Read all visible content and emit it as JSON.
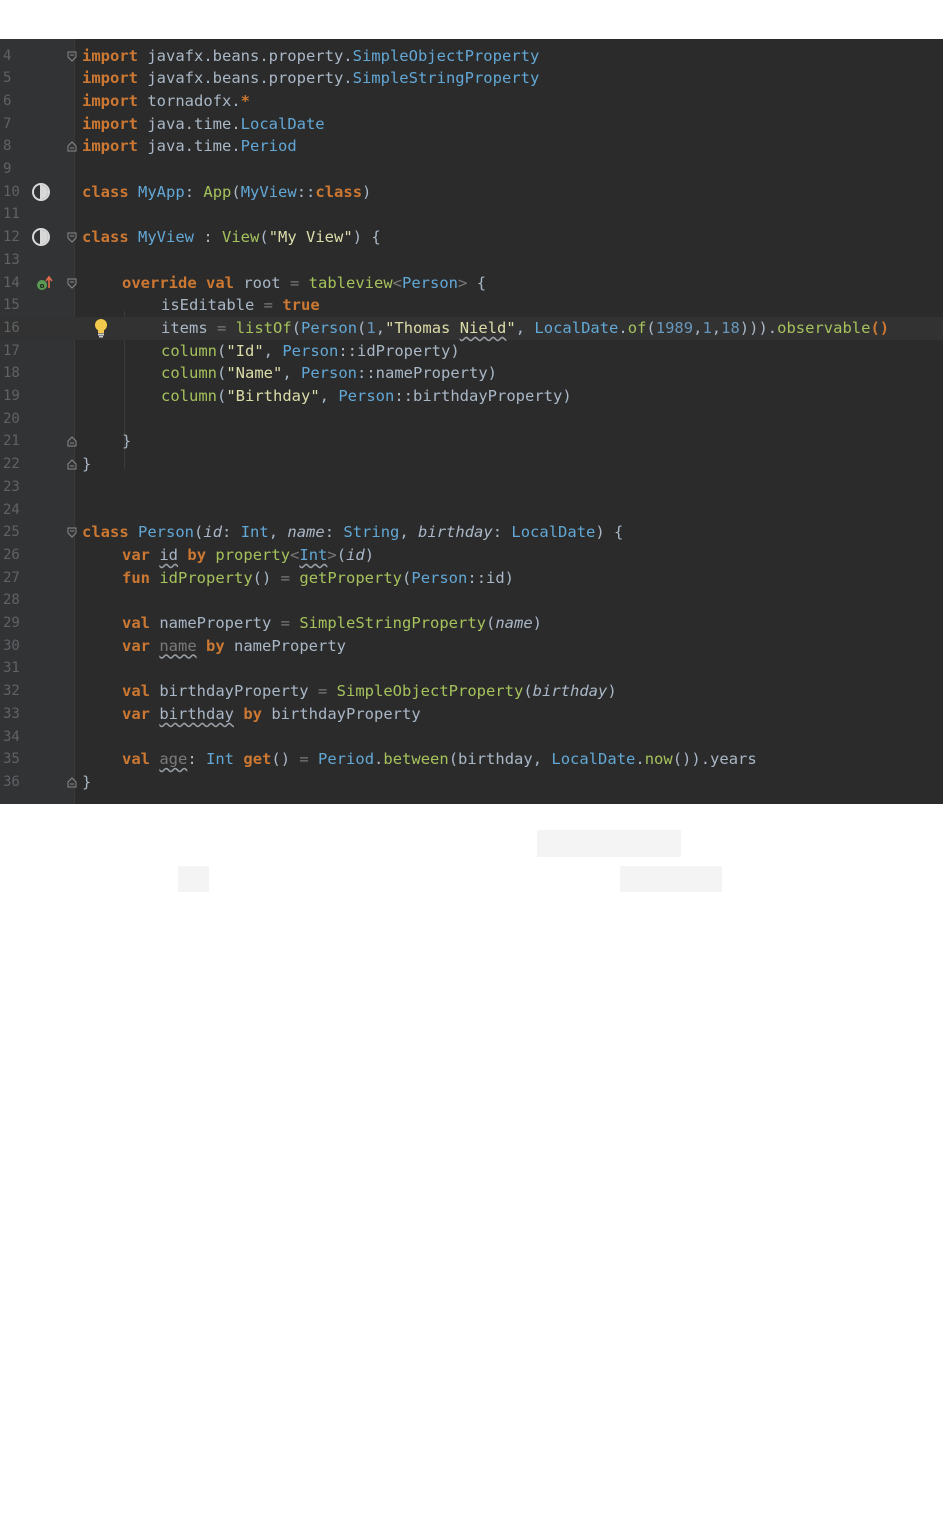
{
  "editor": {
    "lines": [
      {
        "n": "4",
        "parts": [
          {
            "c": "kw",
            "t": "import"
          },
          {
            "c": "",
            "t": " javafx.beans.property."
          },
          {
            "c": "cls",
            "t": "SimpleObjectProperty"
          }
        ]
      },
      {
        "n": "5",
        "parts": [
          {
            "c": "kw",
            "t": "import"
          },
          {
            "c": "",
            "t": " javafx.beans.property."
          },
          {
            "c": "cls",
            "t": "SimpleStringProperty"
          }
        ]
      },
      {
        "n": "6",
        "parts": [
          {
            "c": "kw",
            "t": "import"
          },
          {
            "c": "",
            "t": " tornadofx."
          },
          {
            "c": "kw",
            "t": "*"
          }
        ]
      },
      {
        "n": "7",
        "parts": [
          {
            "c": "kw",
            "t": "import"
          },
          {
            "c": "",
            "t": " java.time."
          },
          {
            "c": "cls",
            "t": "LocalDate"
          }
        ]
      },
      {
        "n": "8",
        "parts": [
          {
            "c": "kw",
            "t": "import"
          },
          {
            "c": "",
            "t": " java.time."
          },
          {
            "c": "cls",
            "t": "Period"
          }
        ]
      },
      {
        "n": "9",
        "parts": []
      },
      {
        "n": "10",
        "parts": [
          {
            "c": "kw",
            "t": "class"
          },
          {
            "c": "",
            "t": " "
          },
          {
            "c": "cls",
            "t": "MyApp"
          },
          {
            "c": "",
            "t": ": "
          },
          {
            "c": "grn",
            "t": "App"
          },
          {
            "c": "",
            "t": "("
          },
          {
            "c": "cls",
            "t": "MyView"
          },
          {
            "c": "",
            "t": "::"
          },
          {
            "c": "kw",
            "t": "class"
          },
          {
            "c": "",
            "t": ")"
          }
        ]
      },
      {
        "n": "11",
        "parts": []
      },
      {
        "n": "12",
        "parts": [
          {
            "c": "kw",
            "t": "class"
          },
          {
            "c": "",
            "t": " "
          },
          {
            "c": "cls",
            "t": "MyView"
          },
          {
            "c": "",
            "t": " : "
          },
          {
            "c": "grn",
            "t": "View"
          },
          {
            "c": "",
            "t": "("
          },
          {
            "c": "str",
            "t": "\"My View\""
          },
          {
            "c": "",
            "t": ") {"
          }
        ]
      },
      {
        "n": "13",
        "parts": []
      },
      {
        "n": "14",
        "parts": [
          {
            "c": "kw",
            "t": "override val"
          },
          {
            "c": "",
            "t": " root "
          },
          {
            "c": "grey",
            "t": "="
          },
          {
            "c": "",
            "t": " "
          },
          {
            "c": "grn",
            "t": "tableview"
          },
          {
            "c": "grey",
            "t": "<"
          },
          {
            "c": "cls",
            "t": "Person"
          },
          {
            "c": "grey",
            "t": ">"
          },
          {
            "c": "",
            "t": " {"
          }
        ]
      },
      {
        "n": "15",
        "parts": [
          {
            "c": "",
            "t": "isEditable "
          },
          {
            "c": "grey",
            "t": "="
          },
          {
            "c": "",
            "t": " "
          },
          {
            "c": "kw",
            "t": "true"
          }
        ]
      },
      {
        "n": "16",
        "parts": [
          {
            "c": "",
            "t": "items "
          },
          {
            "c": "grey",
            "t": "="
          },
          {
            "c": "",
            "t": " "
          },
          {
            "c": "grn",
            "t": "listOf"
          },
          {
            "c": "",
            "t": "("
          },
          {
            "c": "cls",
            "t": "Person"
          },
          {
            "c": "",
            "t": "("
          },
          {
            "c": "num",
            "t": "1"
          },
          {
            "c": "",
            "t": ","
          },
          {
            "c": "str",
            "t": "\"Thomas "
          },
          {
            "c": "str wavy",
            "t": "Nield"
          },
          {
            "c": "str",
            "t": "\""
          },
          {
            "c": "",
            "t": ", "
          },
          {
            "c": "cls",
            "t": "LocalDate"
          },
          {
            "c": "",
            "t": "."
          },
          {
            "c": "grn",
            "t": "of"
          },
          {
            "c": "",
            "t": "("
          },
          {
            "c": "num",
            "t": "1989"
          },
          {
            "c": "",
            "t": ","
          },
          {
            "c": "num",
            "t": "1"
          },
          {
            "c": "",
            "t": ","
          },
          {
            "c": "num",
            "t": "18"
          },
          {
            "c": "",
            "t": ")))."
          },
          {
            "c": "grn",
            "t": "observable"
          },
          {
            "c": "kw",
            "t": "()"
          }
        ]
      },
      {
        "n": "17",
        "parts": [
          {
            "c": "grn",
            "t": "column"
          },
          {
            "c": "",
            "t": "("
          },
          {
            "c": "str",
            "t": "\"Id\""
          },
          {
            "c": "",
            "t": ", "
          },
          {
            "c": "cls",
            "t": "Person"
          },
          {
            "c": "",
            "t": "::idProperty)"
          }
        ]
      },
      {
        "n": "18",
        "parts": [
          {
            "c": "grn",
            "t": "column"
          },
          {
            "c": "",
            "t": "("
          },
          {
            "c": "str",
            "t": "\"Name\""
          },
          {
            "c": "",
            "t": ", "
          },
          {
            "c": "cls",
            "t": "Person"
          },
          {
            "c": "",
            "t": "::nameProperty)"
          }
        ]
      },
      {
        "n": "19",
        "parts": [
          {
            "c": "grn",
            "t": "column"
          },
          {
            "c": "",
            "t": "("
          },
          {
            "c": "str",
            "t": "\"Birthday\""
          },
          {
            "c": "",
            "t": ", "
          },
          {
            "c": "cls",
            "t": "Person"
          },
          {
            "c": "",
            "t": "::birthdayProperty)"
          }
        ]
      },
      {
        "n": "20",
        "parts": []
      },
      {
        "n": "21",
        "parts": [
          {
            "c": "",
            "t": "}"
          }
        ]
      },
      {
        "n": "22",
        "parts": [
          {
            "c": "",
            "t": "}"
          }
        ]
      },
      {
        "n": "23",
        "parts": []
      },
      {
        "n": "24",
        "parts": []
      },
      {
        "n": "25",
        "parts": [
          {
            "c": "kw",
            "t": "class"
          },
          {
            "c": "",
            "t": " "
          },
          {
            "c": "cls",
            "t": "Person"
          },
          {
            "c": "",
            "t": "("
          },
          {
            "c": "itl",
            "t": "id"
          },
          {
            "c": "",
            "t": ": "
          },
          {
            "c": "cls",
            "t": "Int"
          },
          {
            "c": "",
            "t": ", "
          },
          {
            "c": "itl",
            "t": "name"
          },
          {
            "c": "",
            "t": ": "
          },
          {
            "c": "cls",
            "t": "String"
          },
          {
            "c": "",
            "t": ", "
          },
          {
            "c": "itl",
            "t": "birthday"
          },
          {
            "c": "",
            "t": ": "
          },
          {
            "c": "cls",
            "t": "LocalDate"
          },
          {
            "c": "",
            "t": ") {"
          }
        ]
      },
      {
        "n": "26",
        "parts": [
          {
            "c": "kw",
            "t": "var"
          },
          {
            "c": "",
            "t": " "
          },
          {
            "c": "wavy",
            "t": "id"
          },
          {
            "c": "",
            "t": " "
          },
          {
            "c": "kw",
            "t": "by"
          },
          {
            "c": "",
            "t": " "
          },
          {
            "c": "grn",
            "t": "property"
          },
          {
            "c": "grey",
            "t": "<"
          },
          {
            "c": "cls wavy",
            "t": "Int"
          },
          {
            "c": "grey",
            "t": ">"
          },
          {
            "c": "",
            "t": "("
          },
          {
            "c": "itl",
            "t": "id"
          },
          {
            "c": "",
            "t": ")"
          }
        ]
      },
      {
        "n": "27",
        "parts": [
          {
            "c": "kw",
            "t": "fun"
          },
          {
            "c": "",
            "t": " "
          },
          {
            "c": "grn",
            "t": "idProperty"
          },
          {
            "c": "",
            "t": "() "
          },
          {
            "c": "grey",
            "t": "="
          },
          {
            "c": "",
            "t": " "
          },
          {
            "c": "grn",
            "t": "getProperty"
          },
          {
            "c": "",
            "t": "("
          },
          {
            "c": "cls",
            "t": "Person"
          },
          {
            "c": "",
            "t": "::id)"
          }
        ]
      },
      {
        "n": "28",
        "parts": []
      },
      {
        "n": "29",
        "parts": [
          {
            "c": "kw",
            "t": "val"
          },
          {
            "c": "",
            "t": " nameProperty "
          },
          {
            "c": "grey",
            "t": "="
          },
          {
            "c": "",
            "t": " "
          },
          {
            "c": "grn",
            "t": "SimpleStringProperty"
          },
          {
            "c": "",
            "t": "("
          },
          {
            "c": "itl",
            "t": "name"
          },
          {
            "c": "",
            "t": ")"
          }
        ]
      },
      {
        "n": "30",
        "parts": [
          {
            "c": "kw",
            "t": "var"
          },
          {
            "c": "",
            "t": " "
          },
          {
            "c": "grey wavy",
            "t": "name"
          },
          {
            "c": "",
            "t": " "
          },
          {
            "c": "kw",
            "t": "by"
          },
          {
            "c": "",
            "t": " nameProperty"
          }
        ]
      },
      {
        "n": "31",
        "parts": []
      },
      {
        "n": "32",
        "parts": [
          {
            "c": "kw",
            "t": "val"
          },
          {
            "c": "",
            "t": " birthdayProperty "
          },
          {
            "c": "grey",
            "t": "="
          },
          {
            "c": "",
            "t": " "
          },
          {
            "c": "grn",
            "t": "SimpleObjectProperty"
          },
          {
            "c": "",
            "t": "("
          },
          {
            "c": "itl",
            "t": "birthday"
          },
          {
            "c": "",
            "t": ")"
          }
        ]
      },
      {
        "n": "33",
        "parts": [
          {
            "c": "kw",
            "t": "var"
          },
          {
            "c": "",
            "t": " "
          },
          {
            "c": "wavy",
            "t": "birthday"
          },
          {
            "c": "",
            "t": " "
          },
          {
            "c": "kw",
            "t": "by"
          },
          {
            "c": "",
            "t": " birthdayProperty"
          }
        ]
      },
      {
        "n": "34",
        "parts": []
      },
      {
        "n": "35",
        "parts": [
          {
            "c": "kw",
            "t": "val"
          },
          {
            "c": "",
            "t": " "
          },
          {
            "c": "grey wavy",
            "t": "age"
          },
          {
            "c": "",
            "t": ": "
          },
          {
            "c": "cls",
            "t": "Int"
          },
          {
            "c": "",
            "t": " "
          },
          {
            "c": "kw",
            "t": "get"
          },
          {
            "c": "",
            "t": "() "
          },
          {
            "c": "grey",
            "t": "="
          },
          {
            "c": "",
            "t": " "
          },
          {
            "c": "cls",
            "t": "Period"
          },
          {
            "c": "",
            "t": "."
          },
          {
            "c": "grn",
            "t": "between"
          },
          {
            "c": "",
            "t": "(birthday, "
          },
          {
            "c": "cls",
            "t": "LocalDate"
          },
          {
            "c": "",
            "t": "."
          },
          {
            "c": "grn",
            "t": "now"
          },
          {
            "c": "",
            "t": "()).years"
          }
        ]
      },
      {
        "n": "36",
        "parts": [
          {
            "c": "",
            "t": "}"
          }
        ]
      }
    ],
    "current_line": "16",
    "colors": {
      "background": "#2b2b2b",
      "gutter": "#313335",
      "keyword": "#cc7832",
      "type": "#62a8d6",
      "function": "#a5c25c",
      "string": "#dcdcaa",
      "number": "#6897bb",
      "text": "#a9b7c6"
    },
    "gutter_icons": {
      "10": "run-icon",
      "12": "run-icon",
      "14": "override-icon",
      "16": "lightbulb-icon"
    }
  }
}
